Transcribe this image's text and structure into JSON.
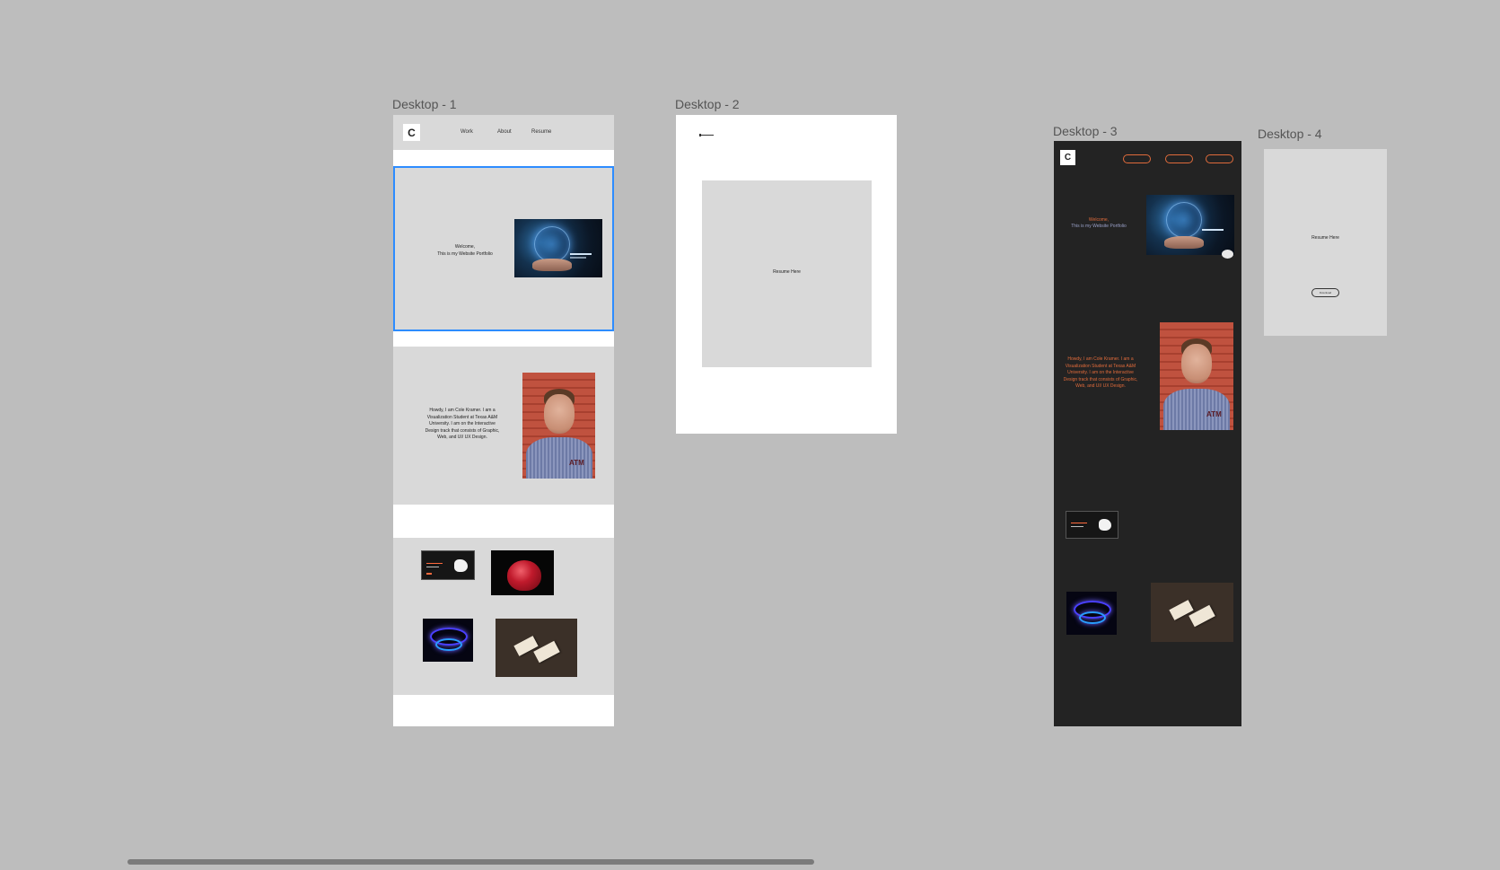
{
  "frames": [
    {
      "label": "Desktop - 1"
    },
    {
      "label": "Desktop - 2"
    },
    {
      "label": "Desktop - 3"
    },
    {
      "label": "Desktop - 4"
    }
  ],
  "logo": {
    "glyph": "C"
  },
  "desktop1": {
    "nav": [
      "Work",
      "About",
      "Resume"
    ],
    "welcome_line1": "Welcome,",
    "welcome_line2": "This is my Website Portfolio",
    "bio": "Howdy, I am Cole Kramer. I am a Visualization Student at Texas A&M University. I am on the Interactive Design track that consists of Graphic, Web, and UI/ UX Design."
  },
  "desktop2": {
    "placeholder": "Resume Here"
  },
  "desktop3": {
    "welcome_line1": "Welcome,",
    "welcome_line2": "This is my Website Portfolio",
    "bio": "Howdy, I am Cole Kramer. I am a Visualization Student at Texas A&M University. I am on the Interactive Design track that consists of Graphic, Web, and UI/ UX Design.",
    "accent": "#e06b3b",
    "background": "#232323"
  },
  "desktop4": {
    "placeholder": "Resume Here",
    "button": "Download"
  },
  "colors": {
    "canvas": "#bdbdbd",
    "selection": "#2d8cff",
    "frame_gray": "#d9d9d9"
  }
}
